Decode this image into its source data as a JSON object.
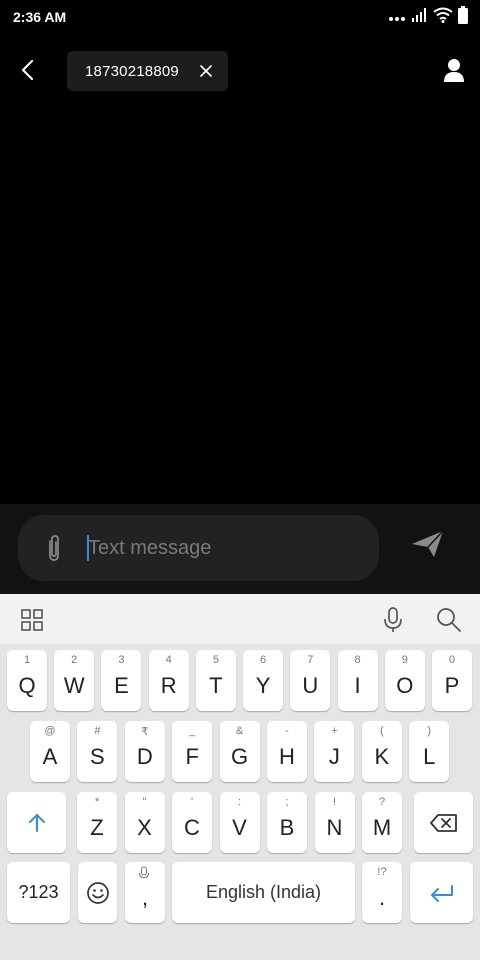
{
  "status_bar": {
    "time": "2:36 AM"
  },
  "header": {
    "recipient_chip": "18730218809"
  },
  "compose": {
    "placeholder": "Text message"
  },
  "keyboard": {
    "row1": [
      {
        "letter": "Q",
        "hint": "1"
      },
      {
        "letter": "W",
        "hint": "2"
      },
      {
        "letter": "E",
        "hint": "3"
      },
      {
        "letter": "R",
        "hint": "4"
      },
      {
        "letter": "T",
        "hint": "5"
      },
      {
        "letter": "Y",
        "hint": "6"
      },
      {
        "letter": "U",
        "hint": "7"
      },
      {
        "letter": "I",
        "hint": "8"
      },
      {
        "letter": "O",
        "hint": "9"
      },
      {
        "letter": "P",
        "hint": "0"
      }
    ],
    "row2": [
      {
        "letter": "A",
        "hint": "@"
      },
      {
        "letter": "S",
        "hint": "#"
      },
      {
        "letter": "D",
        "hint": "₹"
      },
      {
        "letter": "F",
        "hint": "_"
      },
      {
        "letter": "G",
        "hint": "&"
      },
      {
        "letter": "H",
        "hint": "-"
      },
      {
        "letter": "J",
        "hint": "+"
      },
      {
        "letter": "K",
        "hint": "("
      },
      {
        "letter": "L",
        "hint": ")"
      }
    ],
    "row3": [
      {
        "letter": "Z",
        "hint": "*"
      },
      {
        "letter": "X",
        "hint": "\""
      },
      {
        "letter": "C",
        "hint": "'"
      },
      {
        "letter": "V",
        "hint": ":"
      },
      {
        "letter": "B",
        "hint": ";"
      },
      {
        "letter": "N",
        "hint": "!"
      },
      {
        "letter": "M",
        "hint": "?"
      }
    ],
    "symbols_label": "?123",
    "comma_label": ",",
    "space_label": "English (India)",
    "period_label": ".",
    "period_hint": "!?",
    "accent_color": "#2f8fe4"
  },
  "icons": {
    "back": "back-arrow-icon",
    "contact": "person-icon",
    "attach": "paperclip-icon",
    "send": "send-icon",
    "grid": "grid-icon",
    "mic": "microphone-icon",
    "search": "search-icon",
    "shift": "shift-arrow-icon",
    "backspace": "backspace-icon",
    "emoji": "emoji-icon",
    "enter": "enter-icon"
  }
}
